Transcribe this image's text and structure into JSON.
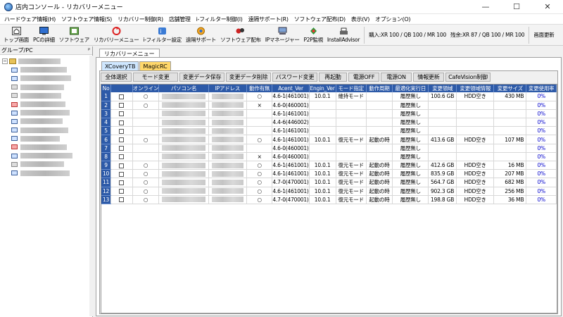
{
  "window": {
    "title": "店内コンソール - リカバリーメニュー",
    "minimize": "—",
    "maximize": "☐",
    "close": "✕"
  },
  "menu": [
    "ハードウェア情報(H)",
    "ソフトウェア情報(S)",
    "リカバリー制御(R)",
    "店舗管理",
    "i-フィルター制御(I)",
    "遠隔サポート(R)",
    "ソフトウェア配布(D)",
    "表示(V)",
    "オプション(O)"
  ],
  "toolbar": {
    "buttons": [
      {
        "label": "トップ画面",
        "icon": "home-icon"
      },
      {
        "label": "PCの詳細",
        "icon": "monitor-icon"
      },
      {
        "label": "ソフトウェア",
        "icon": "software-icon"
      },
      {
        "label": "リカバリーメニュー",
        "icon": "recovery-icon"
      },
      {
        "label": "i-フィルター設定",
        "icon": "filter-icon"
      },
      {
        "label": "遠隔サポート",
        "icon": "support-icon"
      },
      {
        "label": "ソフトウェア配布",
        "icon": "distribute-icon"
      },
      {
        "label": "IPマネージャー",
        "icon": "network-icon"
      },
      {
        "label": "P2P監視",
        "icon": "p2p-icon"
      },
      {
        "label": "InstallAdvisor",
        "icon": "printer-icon"
      }
    ],
    "license_purchased": "購入:XR 100 / QB 100 / MR 100",
    "license_remaining": "残余:XR 87 / QB 100 / MR 100",
    "refresh": "画面更新"
  },
  "left_panel": {
    "header": "グループ/PC",
    "pin": "ᴾ"
  },
  "tabs": {
    "outer": "リカバリーメニュー",
    "inner": [
      "XCoveryTB",
      "MagicRC"
    ]
  },
  "actions": [
    "全体選択",
    "モード変更",
    "変更データ保存",
    "変更データ削除",
    "パスワード変更",
    "再起動",
    "電源OFF",
    "電源ON",
    "情報更新",
    "CafeVision制御"
  ],
  "table": {
    "columns": [
      "No",
      "",
      "オンライン",
      "パソコン名",
      "IPアドレス",
      "動作有無",
      "Acent_Ver",
      "Engin_Ver",
      "モード指定",
      "動作周期",
      "最適化実行日",
      "変更領域",
      "変更領域情報",
      "変更サイズ",
      "変更使用率"
    ],
    "rows": [
      [
        "1",
        "",
        "○",
        "",
        "",
        "○",
        "4.6-1(461001)",
        "10.0.1",
        "維持モード",
        "",
        "履歴無し",
        "100.6 GB",
        "HDD空き",
        "430 MB",
        "0%"
      ],
      [
        "2",
        "",
        "○",
        "",
        "",
        "×",
        "4.6-0(460001)",
        "",
        "",
        "",
        "履歴無し",
        "",
        "",
        "",
        "0%"
      ],
      [
        "3",
        "",
        "",
        "",
        "",
        "",
        "4.6-1(461001)",
        "",
        "",
        "",
        "履歴無し",
        "",
        "",
        "",
        "0%"
      ],
      [
        "4",
        "",
        "",
        "",
        "",
        "",
        "4.4-6(446002)",
        "",
        "",
        "",
        "履歴無し",
        "",
        "",
        "",
        "0%"
      ],
      [
        "5",
        "",
        "",
        "",
        "",
        "",
        "4.6-1(461001)",
        "",
        "",
        "",
        "履歴無し",
        "",
        "",
        "",
        "0%"
      ],
      [
        "6",
        "",
        "○",
        "",
        "",
        "○",
        "4.6-1(461001)",
        "10.0.1",
        "復元モード",
        "起動の時",
        "履歴無し",
        "413.6 GB",
        "HDD空き",
        "107 MB",
        "0%"
      ],
      [
        "7",
        "",
        "",
        "",
        "",
        "",
        "4.6-0(460001)",
        "",
        "",
        "",
        "履歴無し",
        "",
        "",
        "",
        "0%"
      ],
      [
        "8",
        "",
        "",
        "",
        "",
        "×",
        "4.6-0(460001)",
        "",
        "",
        "",
        "履歴無し",
        "",
        "",
        "",
        "0%"
      ],
      [
        "9",
        "",
        "○",
        "",
        "",
        "○",
        "4.6-1(461001)",
        "10.0.1",
        "復元モード",
        "起動の時",
        "履歴無し",
        "412.6 GB",
        "HDD空き",
        "16 MB",
        "0%"
      ],
      [
        "10",
        "",
        "○",
        "",
        "",
        "○",
        "4.6-1(461001)",
        "10.0.1",
        "復元モード",
        "起動の時",
        "履歴無し",
        "835.9 GB",
        "HDD空き",
        "207 MB",
        "0%"
      ],
      [
        "11",
        "",
        "○",
        "",
        "",
        "○",
        "4.7-0(470001)",
        "10.0.1",
        "復元モード",
        "起動の時",
        "履歴無し",
        "564.7 GB",
        "HDD空き",
        "682 MB",
        "0%"
      ],
      [
        "12",
        "",
        "○",
        "",
        "",
        "○",
        "4.6-1(461001)",
        "10.0.1",
        "復元モード",
        "起動の時",
        "履歴無し",
        "902.3 GB",
        "HDD空き",
        "256 MB",
        "0%"
      ],
      [
        "13",
        "",
        "○",
        "",
        "",
        "○",
        "4.7-0(470001)",
        "10.0.1",
        "復元モード",
        "起動の時",
        "履歴無し",
        "198.8 GB",
        "HDD空き",
        "36 MB",
        "0%"
      ]
    ]
  },
  "colors": {
    "header_bg": "#2d5aa8",
    "percent": "#0000cc",
    "tab_xcovery": "#cfe7ff",
    "tab_magicrc": "#ffd76a"
  }
}
